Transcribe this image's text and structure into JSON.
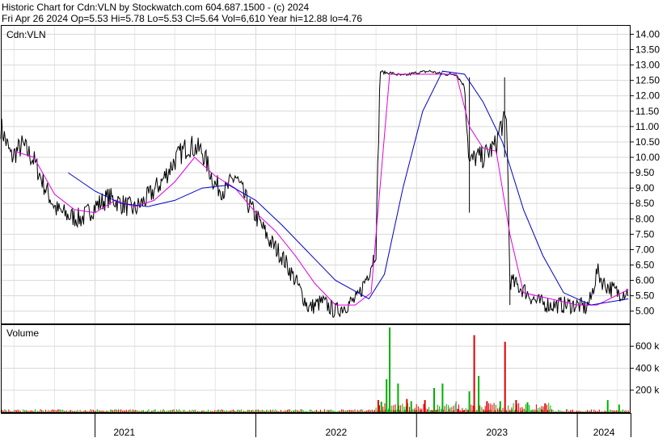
{
  "header": {
    "title_line": "Historic Chart for Cdn:VLN by Stockwatch.com 604.687.1500 - (c) 2024",
    "quote_line": "Fri Apr 26 2024   Op=5.53   Hi=5.78   Lo=5.53   Cl=5.64   Vol=6,610   Year hi=12.88   lo=4.76"
  },
  "price_panel": {
    "label": "Cdn:VLN"
  },
  "volume_panel": {
    "label": "Volume"
  },
  "chart_data": [
    {
      "type": "line",
      "title": "Cdn:VLN",
      "x_axis": {
        "tick_labels": [
          "2021",
          "2022",
          "2023",
          "2024"
        ]
      },
      "y_axis": {
        "ylim": [
          4.6,
          14.3
        ],
        "tick_labels": [
          "5.00",
          "5.50",
          "6.00",
          "6.50",
          "7.00",
          "7.50",
          "8.00",
          "8.50",
          "9.00",
          "9.50",
          "10.00",
          "10.50",
          "11.00",
          "11.50",
          "12.00",
          "12.50",
          "13.00",
          "13.50",
          "14.00"
        ],
        "position": "right"
      },
      "grid": true,
      "colors": {
        "price": "#000000",
        "ma_short": "#e000e0",
        "ma_long": "#0000c8",
        "grid": "#d8d8d8"
      },
      "series": [
        {
          "name": "",
          "x": [
            "2020-06-01",
            "2020-06-25",
            "2020-07-20",
            "2020-08-15",
            "2020-09-10",
            "2020-10-05",
            "2020-11-01",
            "2020-12-01",
            "2021-01-01",
            "2021-02-01",
            "2021-03-01",
            "2021-04-01",
            "2021-05-01",
            "2021-06-01",
            "2021-07-01",
            "2021-08-01",
            "2021-09-01",
            "2021-10-01",
            "2021-10-25",
            "2021-11-15",
            "2021-12-10",
            "2022-01-05",
            "2022-02-01",
            "2022-03-01",
            "2022-04-01",
            "2022-05-01",
            "2022-06-01",
            "2022-07-01",
            "2022-07-25",
            "2022-08-20",
            "2022-09-15",
            "2022-10-01",
            "2022-10-10",
            "2022-10-20",
            "2022-11-01",
            "2022-11-15",
            "2022-12-01",
            "2023-01-01",
            "2023-02-01",
            "2023-03-01",
            "2023-04-01",
            "2023-04-20",
            "2023-05-01",
            "2023-05-15",
            "2023-06-01",
            "2023-06-15",
            "2023-07-01",
            "2023-07-10",
            "2023-07-25",
            "2023-08-01",
            "2023-08-20",
            "2023-09-01",
            "2023-10-01",
            "2023-11-01",
            "2023-12-01",
            "2024-01-01",
            "2024-01-20",
            "2024-02-01",
            "2024-02-15",
            "2024-03-01",
            "2024-04-01",
            "2024-04-26"
          ],
          "values": [
            11.0,
            10.0,
            10.4,
            9.9,
            9.0,
            8.3,
            8.1,
            8.0,
            8.4,
            8.7,
            8.5,
            8.3,
            8.7,
            9.2,
            9.9,
            10.4,
            10.2,
            9.1,
            8.9,
            9.4,
            8.6,
            8.0,
            7.3,
            6.8,
            6.0,
            5.1,
            5.3,
            5.0,
            5.2,
            5.4,
            6.3,
            7.0,
            12.8,
            12.75,
            12.75,
            12.7,
            12.65,
            12.75,
            12.8,
            12.7,
            12.7,
            12.3,
            9.8,
            10.0,
            10.0,
            10.2,
            10.4,
            11.0,
            11.2,
            6.0,
            5.8,
            5.7,
            5.3,
            5.2,
            5.2,
            5.2,
            5.1,
            5.4,
            6.3,
            5.9,
            5.6,
            5.64
          ]
        },
        {
          "name": "",
          "x": [
            "2020-07-01",
            "2020-08-15",
            "2020-10-01",
            "2020-11-15",
            "2021-01-01",
            "2021-02-15",
            "2021-04-01",
            "2021-05-15",
            "2021-07-01",
            "2021-08-15",
            "2021-09-30",
            "2021-11-15",
            "2022-01-01",
            "2022-02-15",
            "2022-04-01",
            "2022-05-15",
            "2022-07-01",
            "2022-08-15",
            "2022-09-20",
            "2022-10-10",
            "2022-11-01",
            "2023-01-01",
            "2023-03-01",
            "2023-04-01",
            "2023-05-01",
            "2023-06-01",
            "2023-07-01",
            "2023-08-01",
            "2023-09-01",
            "2023-11-01",
            "2024-01-01",
            "2024-02-15",
            "2024-04-26"
          ],
          "values": [
            10.2,
            10.0,
            8.8,
            8.3,
            8.2,
            8.6,
            8.4,
            8.6,
            9.2,
            10.0,
            9.4,
            9.0,
            8.2,
            7.6,
            6.8,
            5.9,
            5.2,
            5.2,
            5.6,
            9.0,
            12.7,
            12.7,
            12.7,
            12.7,
            11.0,
            10.3,
            10.2,
            7.5,
            5.6,
            5.4,
            5.2,
            5.2,
            5.7
          ]
        },
        {
          "name": "",
          "x": [
            "2020-11-01",
            "2021-01-01",
            "2021-03-01",
            "2021-05-01",
            "2021-07-01",
            "2021-09-01",
            "2021-11-01",
            "2022-01-01",
            "2022-03-01",
            "2022-05-01",
            "2022-07-01",
            "2022-09-15",
            "2022-10-20",
            "2022-12-01",
            "2023-01-15",
            "2023-03-01",
            "2023-04-20",
            "2023-06-01",
            "2023-07-15",
            "2023-09-01",
            "2023-10-15",
            "2023-12-01",
            "2024-02-01",
            "2024-04-26"
          ],
          "values": [
            9.5,
            8.9,
            8.5,
            8.4,
            8.6,
            9.0,
            9.1,
            8.6,
            7.8,
            6.9,
            6.0,
            5.4,
            6.2,
            9.0,
            11.5,
            12.8,
            12.7,
            11.8,
            10.5,
            8.3,
            6.8,
            5.6,
            5.2,
            5.4
          ]
        }
      ]
    },
    {
      "type": "bar",
      "title": "Volume",
      "x_axis": {
        "tick_labels": [
          "2021",
          "2022",
          "2023",
          "2024"
        ]
      },
      "y_axis": {
        "ylim": [
          0,
          770000
        ],
        "tick_labels": [
          "200 k",
          "400 k",
          "600 k"
        ],
        "position": "right"
      },
      "grid": true,
      "colors": {
        "up": "#00b000",
        "down": "#e00000",
        "flat": "#a0a0a0"
      },
      "spikes": [
        {
          "date": "2022-11-01",
          "value": 770000,
          "color": "up"
        },
        {
          "date": "2022-10-25",
          "value": 300000,
          "color": "up"
        },
        {
          "date": "2022-10-06",
          "value": 110000,
          "color": "down"
        },
        {
          "date": "2022-10-13",
          "value": 95000,
          "color": "up"
        },
        {
          "date": "2022-11-20",
          "value": 260000,
          "color": "up"
        },
        {
          "date": "2022-12-10",
          "value": 120000,
          "color": "down"
        },
        {
          "date": "2022-12-20",
          "value": 100000,
          "color": "up"
        },
        {
          "date": "2023-01-20",
          "value": 110000,
          "color": "down"
        },
        {
          "date": "2023-02-10",
          "value": 220000,
          "color": "up"
        },
        {
          "date": "2023-03-01",
          "value": 260000,
          "color": "up"
        },
        {
          "date": "2023-04-01",
          "value": 100000,
          "color": "flat"
        },
        {
          "date": "2023-05-01",
          "value": 190000,
          "color": "up"
        },
        {
          "date": "2023-05-12",
          "value": 700000,
          "color": "down"
        },
        {
          "date": "2023-05-22",
          "value": 330000,
          "color": "up"
        },
        {
          "date": "2023-06-10",
          "value": 100000,
          "color": "down"
        },
        {
          "date": "2023-07-10",
          "value": 100000,
          "color": "up"
        },
        {
          "date": "2023-07-21",
          "value": 640000,
          "color": "down"
        },
        {
          "date": "2023-08-15",
          "value": 110000,
          "color": "down"
        },
        {
          "date": "2023-09-10",
          "value": 90000,
          "color": "up"
        },
        {
          "date": "2023-10-20",
          "value": 80000,
          "color": "down"
        },
        {
          "date": "2024-03-10",
          "value": 110000,
          "color": "up"
        },
        {
          "date": "2024-04-05",
          "value": 70000,
          "color": "up"
        }
      ]
    }
  ]
}
